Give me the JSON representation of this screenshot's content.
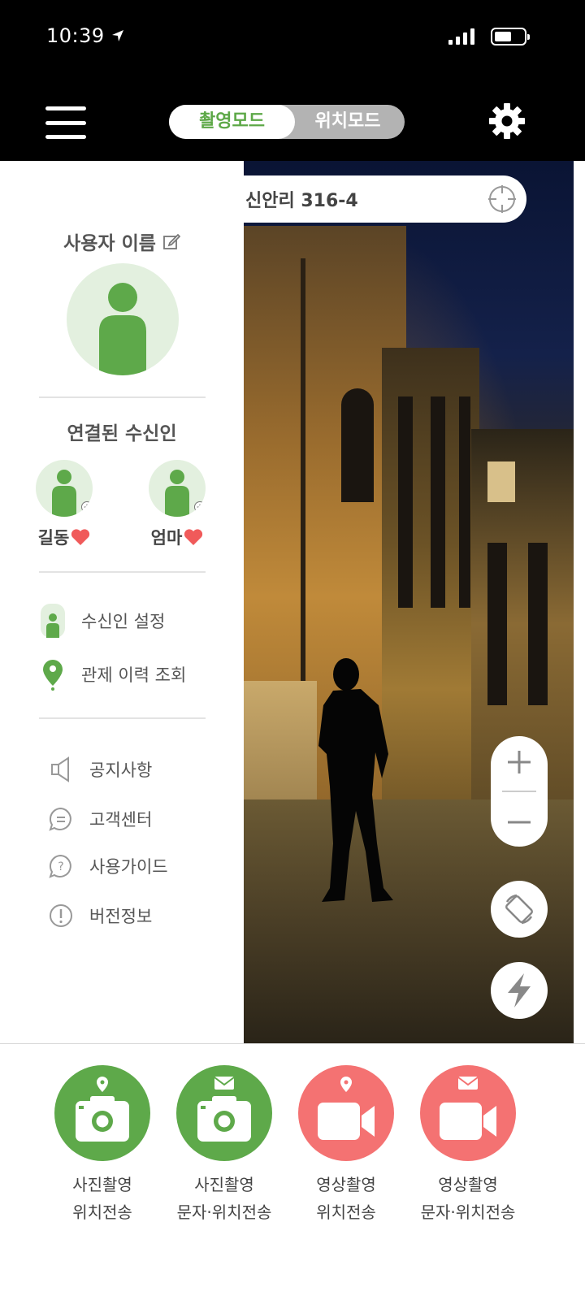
{
  "status_bar": {
    "time": "10:39"
  },
  "header": {
    "mode_active": "촬영모드",
    "mode_inactive": "위치모드"
  },
  "camera": {
    "address": "신안리 316-4"
  },
  "drawer": {
    "user_name": "사용자 이름",
    "recipients_title": "연결된 수신인",
    "recipients": [
      {
        "name": "길동"
      },
      {
        "name": "엄마"
      }
    ],
    "primary_menu": [
      {
        "label": "수신인 설정",
        "icon": "person-icon"
      },
      {
        "label": "관제 이력 조회",
        "icon": "location-pin-icon"
      }
    ],
    "secondary_menu": [
      {
        "label": "공지사항",
        "icon": "speaker-icon"
      },
      {
        "label": "고객센터",
        "icon": "chat-icon"
      },
      {
        "label": "사용가이드",
        "icon": "question-icon"
      },
      {
        "label": "버전정보",
        "icon": "info-icon"
      }
    ]
  },
  "capture_buttons": [
    {
      "line1": "사진촬영",
      "line2": "위치전송",
      "color": "#5ea94a",
      "icon": "photo-location-icon"
    },
    {
      "line1": "사진촬영",
      "line2": "문자·위치전송",
      "color": "#5ea94a",
      "icon": "photo-message-icon"
    },
    {
      "line1": "영상촬영",
      "line2": "위치전송",
      "color": "#f47272",
      "icon": "video-location-icon"
    },
    {
      "line1": "영상촬영",
      "line2": "문자·위치전송",
      "color": "#f47272",
      "icon": "video-message-icon"
    }
  ],
  "colors": {
    "green": "#5ea94a",
    "red": "#f47272",
    "heart": "#f05a5a"
  }
}
